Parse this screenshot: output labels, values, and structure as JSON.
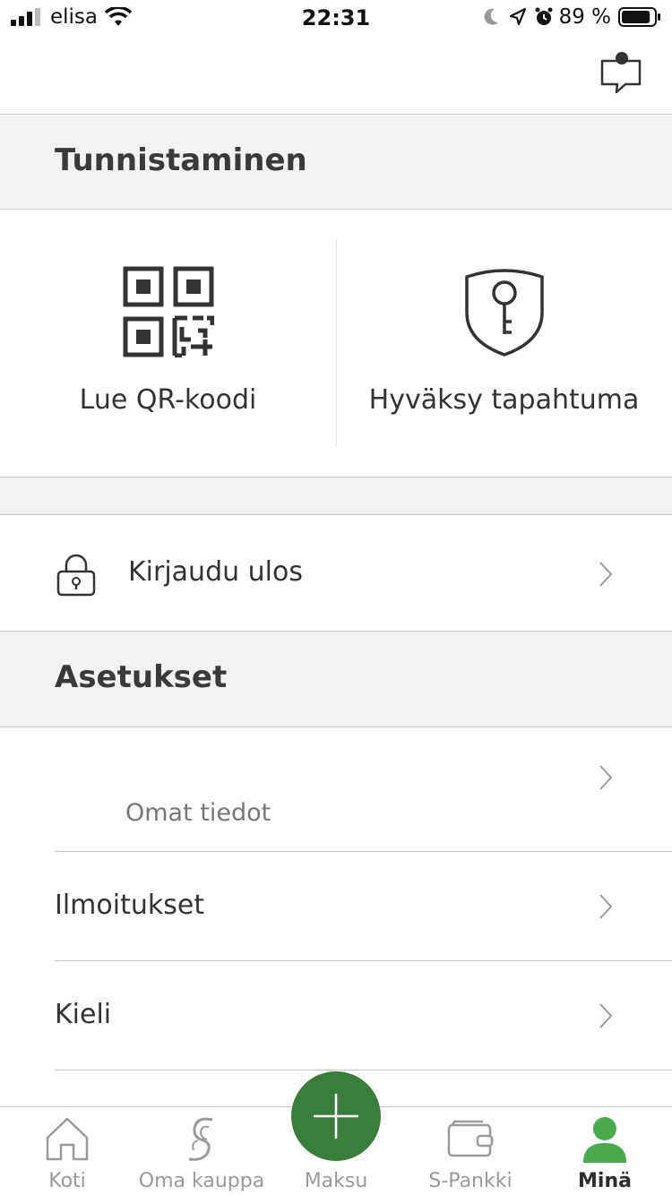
{
  "status_bar": {
    "carrier": "elisa",
    "time": "22:31",
    "battery_percent": "89 %",
    "battery_level": 0.89
  },
  "header": {
    "chat_icon": "chat-bubble-icon"
  },
  "identification": {
    "title": "Tunnistaminen",
    "tiles": [
      {
        "label": "Lue QR-koodi",
        "icon": "qr-code-icon"
      },
      {
        "label": "Hyväksy tapahtuma",
        "icon": "shield-key-icon"
      }
    ]
  },
  "logout": {
    "label": "Kirjaudu ulos",
    "icon": "padlock-icon"
  },
  "settings": {
    "title": "Asetukset",
    "items": [
      {
        "label": "Omat tiedot"
      },
      {
        "label": "Ilmoitukset"
      },
      {
        "label": "Kieli"
      }
    ]
  },
  "tab_bar": {
    "tabs": [
      {
        "label": "Koti",
        "icon": "home-icon"
      },
      {
        "label": "Oma kauppa",
        "icon": "s-logo-icon"
      },
      {
        "label": "Maksu",
        "icon": "plus-icon"
      },
      {
        "label": "S-Pankki",
        "icon": "wallet-icon"
      },
      {
        "label": "Minä",
        "icon": "person-icon"
      }
    ],
    "active_index": 4,
    "colors": {
      "accent": "#3a7d3c",
      "active_icon": "#4aa84d",
      "inactive": "#9a9a9a"
    }
  }
}
